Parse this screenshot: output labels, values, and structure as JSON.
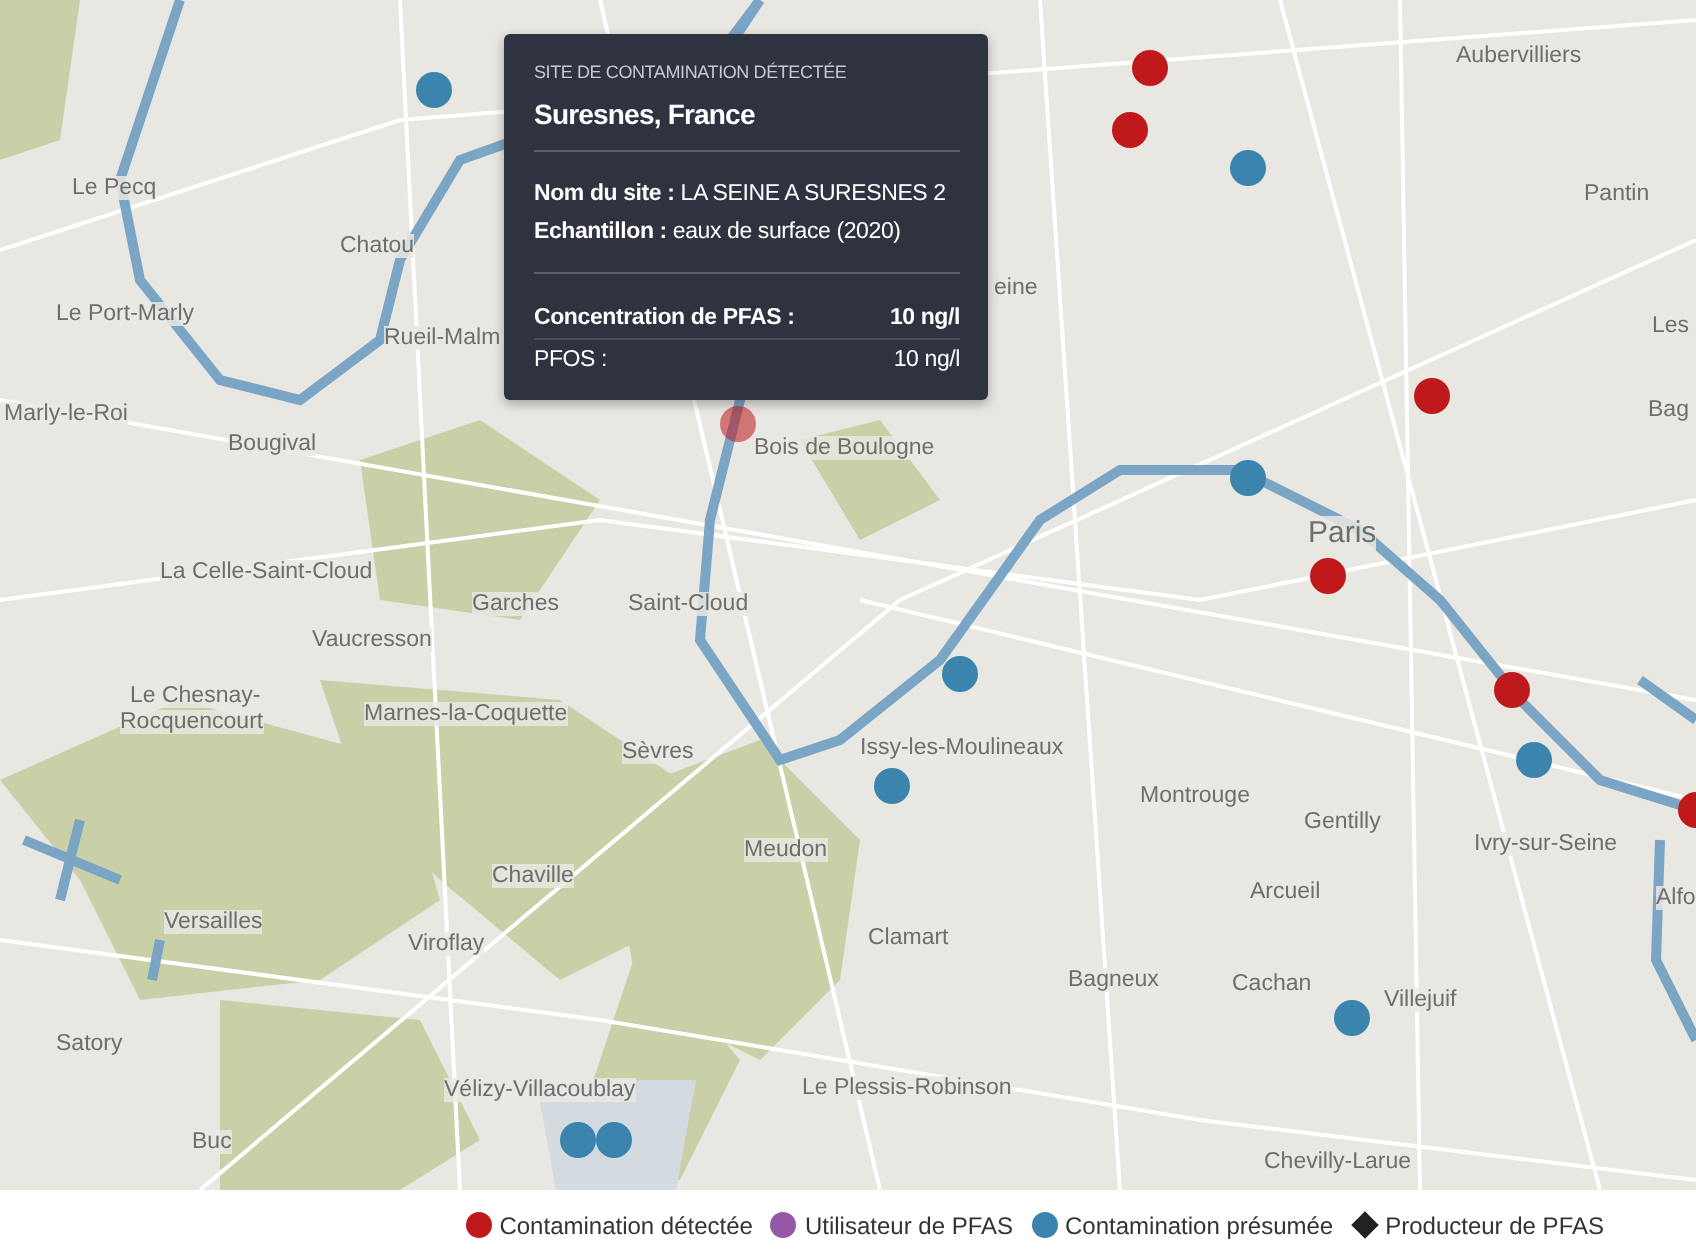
{
  "map": {
    "places": [
      {
        "name": "Aubervilliers",
        "kind": "town"
      },
      {
        "name": "Le Pecq",
        "kind": "town"
      },
      {
        "name": "Pantin",
        "kind": "town"
      },
      {
        "name": "Chatou",
        "kind": "town"
      },
      {
        "name": "eine",
        "kind": "town"
      },
      {
        "name": "Le Port-Marly",
        "kind": "town"
      },
      {
        "name": "Rueil-Malm",
        "kind": "town"
      },
      {
        "name": "Les",
        "kind": "town"
      },
      {
        "name": "Marly-le-Roi",
        "kind": "town"
      },
      {
        "name": "Bag",
        "kind": "town"
      },
      {
        "name": "Bougival",
        "kind": "town"
      },
      {
        "name": "Bois de Boulogne",
        "kind": "town"
      },
      {
        "name": "Paris",
        "kind": "city"
      },
      {
        "name": "La Celle-Saint-Cloud",
        "kind": "town"
      },
      {
        "name": "Garches",
        "kind": "town"
      },
      {
        "name": "Saint-Cloud",
        "kind": "town"
      },
      {
        "name": "Vaucresson",
        "kind": "town"
      },
      {
        "name": "Le Chesnay-",
        "kind": "town"
      },
      {
        "name": "Rocquencourt",
        "kind": "town"
      },
      {
        "name": "Marnes-la-Coquette",
        "kind": "town"
      },
      {
        "name": "Sèvres",
        "kind": "town"
      },
      {
        "name": "Issy-les-Moulineaux",
        "kind": "town"
      },
      {
        "name": "Montrouge",
        "kind": "town"
      },
      {
        "name": "Gentilly",
        "kind": "town"
      },
      {
        "name": "Meudon",
        "kind": "town"
      },
      {
        "name": "Ivry-sur-Seine",
        "kind": "town"
      },
      {
        "name": "Chaville",
        "kind": "town"
      },
      {
        "name": "Arcueil",
        "kind": "town"
      },
      {
        "name": "Alfo",
        "kind": "town"
      },
      {
        "name": "Versailles",
        "kind": "town"
      },
      {
        "name": "Viroflay",
        "kind": "town"
      },
      {
        "name": "Clamart",
        "kind": "town"
      },
      {
        "name": "Bagneux",
        "kind": "town"
      },
      {
        "name": "Cachan",
        "kind": "town"
      },
      {
        "name": "Villejuif",
        "kind": "town"
      },
      {
        "name": "Satory",
        "kind": "town"
      },
      {
        "name": "Vélizy-Villacoublay",
        "kind": "town"
      },
      {
        "name": "Le Plessis-Robinson",
        "kind": "town"
      },
      {
        "name": "Buc",
        "kind": "town"
      },
      {
        "name": "Chevilly-Larue",
        "kind": "town"
      }
    ],
    "markers": [
      {
        "kind": "detected",
        "selected": false
      },
      {
        "kind": "detected",
        "selected": false
      },
      {
        "kind": "detected",
        "selected": false
      },
      {
        "kind": "detected",
        "selected": false
      },
      {
        "kind": "detected",
        "selected": false
      },
      {
        "kind": "detected",
        "selected": false
      },
      {
        "kind": "presumed",
        "selected": false
      },
      {
        "kind": "presumed",
        "selected": false
      },
      {
        "kind": "presumed",
        "selected": false
      },
      {
        "kind": "presumed",
        "selected": false
      },
      {
        "kind": "presumed",
        "selected": false
      },
      {
        "kind": "presumed",
        "selected": false
      },
      {
        "kind": "presumed",
        "selected": false
      },
      {
        "kind": "presumed",
        "selected": false
      },
      {
        "kind": "presumed",
        "selected": false
      },
      {
        "kind": "detected",
        "selected": true
      }
    ]
  },
  "tooltip": {
    "eyebrow": "SITE DE CONTAMINATION DÉTECTÉE",
    "title": "Suresnes, France",
    "details": [
      {
        "label": "Nom du site :",
        "value": "LA SEINE A SURESNES 2"
      },
      {
        "label": "Echantillon :",
        "value": "eaux de surface (2020)"
      }
    ],
    "measures": [
      {
        "label": "Concentration de PFAS :",
        "value": "10 ng/l",
        "strong": true
      },
      {
        "label": "PFOS :",
        "value": "10 ng/l",
        "strong": false
      }
    ]
  },
  "legend": [
    {
      "kind": "detected",
      "label": "Contamination détectée",
      "color": "#c0191c"
    },
    {
      "kind": "user",
      "label": "Utilisateur de PFAS",
      "color": "#9558a6"
    },
    {
      "kind": "presumed",
      "label": "Contamination présumée",
      "color": "#3a84ad"
    },
    {
      "kind": "producer",
      "label": "Producteur de PFAS",
      "color": "#222222"
    }
  ]
}
